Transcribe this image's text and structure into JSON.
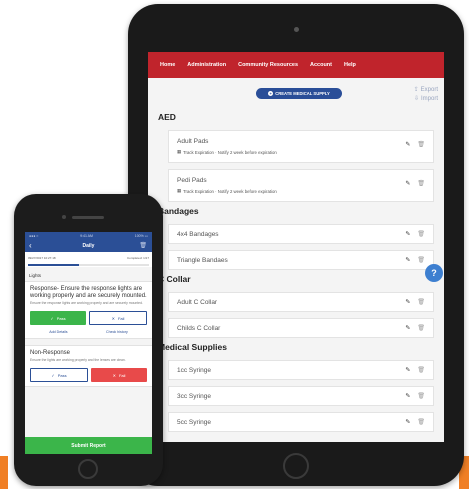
{
  "tablet": {
    "nav": [
      "Home",
      "Administration",
      "Community Resources",
      "Account",
      "Help"
    ],
    "create_button": "CREATE MEDICAL SUPPLY",
    "export_label": "Export",
    "import_label": "Import",
    "sections": [
      {
        "title": "AED",
        "items": [
          {
            "name": "Adult Pads",
            "sub": "Track Expiration · Notify 2 week before expiration"
          },
          {
            "name": "Pedi Pads",
            "sub": "Track Expiration · Notify 2 week before expiration"
          }
        ]
      },
      {
        "title": "Bandages",
        "items": [
          {
            "name": "4x4 Bandages"
          },
          {
            "name": "Triangle Bandaes"
          }
        ]
      },
      {
        "title": "C Collar",
        "items": [
          {
            "name": "Adult C Collar"
          },
          {
            "name": "Childs C Collar"
          }
        ]
      },
      {
        "title": "Medical Supplies",
        "items": [
          {
            "name": "1cc Syringe"
          },
          {
            "name": "3cc Syringe"
          },
          {
            "name": "5cc Syringe"
          }
        ]
      }
    ],
    "colors": {
      "navbar": "#c0242c",
      "button": "#2a4e98",
      "help": "#3d7fd0"
    }
  },
  "phone": {
    "status_left": "●●● ≈",
    "status_center": "9:41 AM",
    "status_right": "100% ▭",
    "title": "Daily",
    "date": "09/27/2017 10:27:18",
    "progress_label": "Completed: 1/17",
    "progress": 0.42,
    "category": "Lights",
    "checks": [
      {
        "title": "Response- Ensure the response lights are working properly and are securely mounted.",
        "desc": "Ensure the response lights are working properly and are securely mounted.",
        "pass_label": "Pass",
        "fail_label": "Fail",
        "state": "pass",
        "add_details": "Add Details",
        "check_history": "Check history"
      },
      {
        "title": "Non-Response",
        "desc": "Ensure the lights are working properly and the lenses are clean.",
        "pass_label": "Pass",
        "fail_label": "Fail",
        "state": "fail"
      }
    ],
    "submit_label": "Submit Report",
    "colors": {
      "header": "#2b4f96",
      "pass": "#3bb54a",
      "fail": "#e84a4a"
    }
  }
}
